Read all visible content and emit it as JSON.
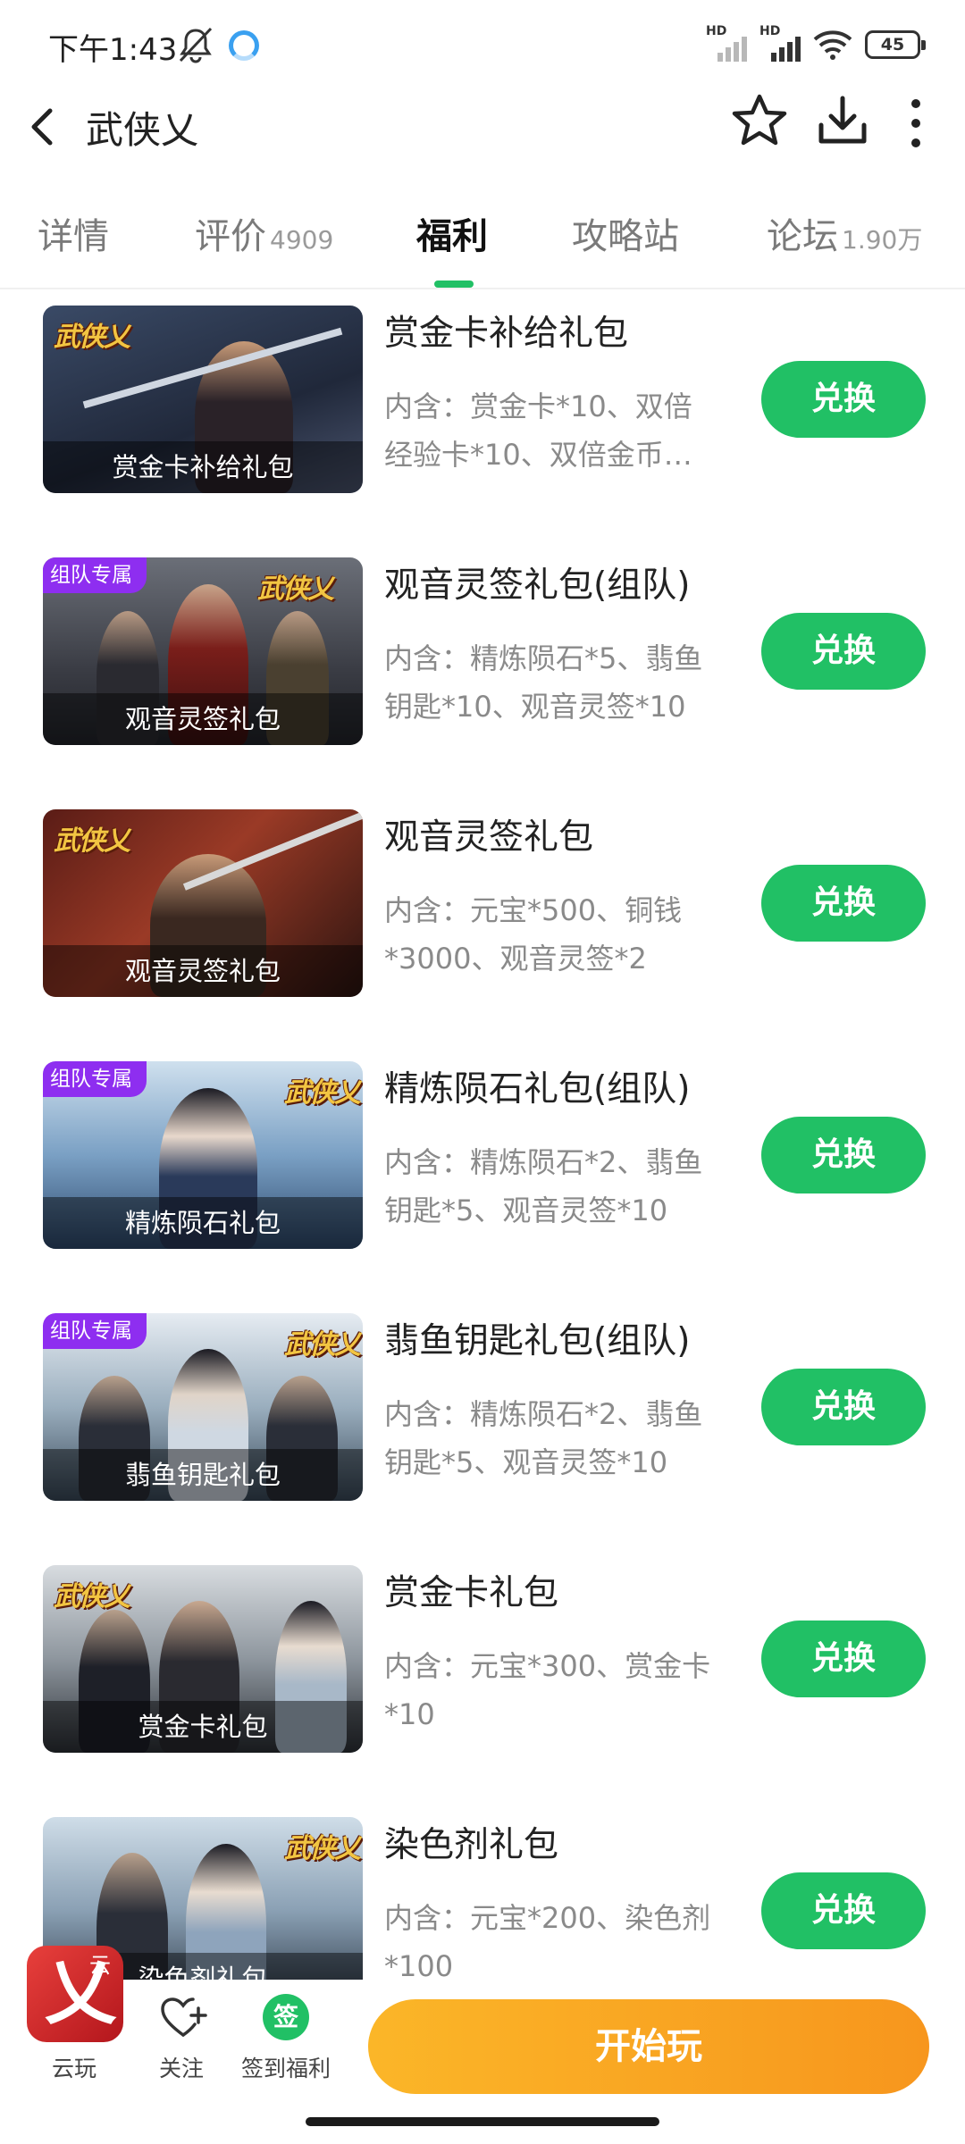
{
  "status_bar": {
    "time": "下午1:43",
    "battery": "45",
    "signal_labels": [
      "HD",
      "HD"
    ]
  },
  "header": {
    "title": "武侠乂"
  },
  "tabs": [
    {
      "label": "详情",
      "count": ""
    },
    {
      "label": "评价",
      "count": "4909"
    },
    {
      "label": "福利",
      "count": "",
      "active": true
    },
    {
      "label": "攻略站",
      "count": ""
    },
    {
      "label": "论坛",
      "count": "1.90万"
    }
  ],
  "game_logo_text": "武侠乂",
  "gifts": [
    {
      "name": "赏金卡补给礼包",
      "desc": "内含：赏金卡*10、双倍\n经验卡*10、双倍金币…",
      "thumb_caption": "赏金卡补给礼包",
      "badge": "",
      "button": "兑换"
    },
    {
      "name": "观音灵签礼包(组队)",
      "desc": "内含：精炼陨石*5、翡鱼\n钥匙*10、观音灵签*10",
      "thumb_caption": "观音灵签礼包",
      "badge": "组队专属",
      "button": "兑换"
    },
    {
      "name": "观音灵签礼包",
      "desc": "内含：元宝*500、铜钱\n*3000、观音灵签*2",
      "thumb_caption": "观音灵签礼包",
      "badge": "",
      "button": "兑换"
    },
    {
      "name": "精炼陨石礼包(组队)",
      "desc": "内含：精炼陨石*2、翡鱼\n钥匙*5、观音灵签*10",
      "thumb_caption": "精炼陨石礼包",
      "badge": "组队专属",
      "button": "兑换"
    },
    {
      "name": "翡鱼钥匙礼包(组队)",
      "desc": "内含：精炼陨石*2、翡鱼\n钥匙*5、观音灵签*10",
      "thumb_caption": "翡鱼钥匙礼包",
      "badge": "组队专属",
      "button": "兑换"
    },
    {
      "name": "赏金卡礼包",
      "desc": "内含：元宝*300、赏金卡\n*10",
      "thumb_caption": "赏金卡礼包",
      "badge": "",
      "button": "兑换"
    },
    {
      "name": "染色剂礼包",
      "desc": "内含：元宝*200、染色剂\n*100",
      "thumb_caption": "染色剂礼包",
      "badge": "",
      "button": "兑换"
    }
  ],
  "bottom_bar": {
    "cloud_play_label": "云玩",
    "cloud_play_mini": "云",
    "follow_label": "关注",
    "sign_icon_text": "签",
    "sign_label": "签到福利",
    "start_label": "开始玩"
  },
  "colors": {
    "accent_green": "#21c065",
    "start_orange": "#f7a21f",
    "team_badge_purple": "#8e2ef0"
  }
}
